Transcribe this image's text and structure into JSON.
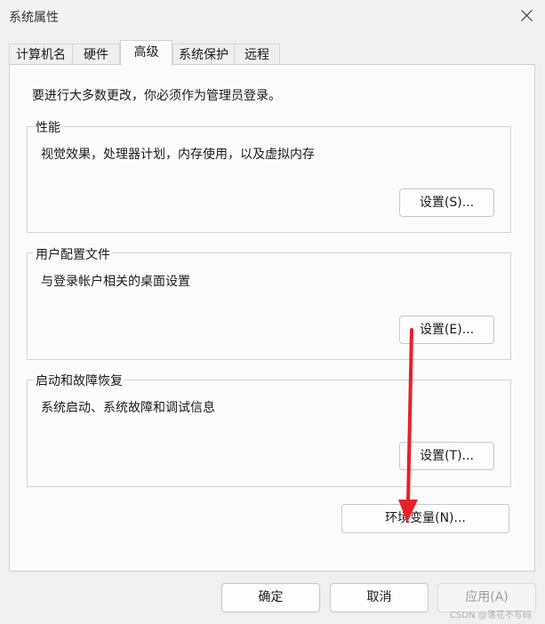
{
  "window": {
    "title": "系统属性"
  },
  "tabs": [
    {
      "label": "计算机名"
    },
    {
      "label": "硬件"
    },
    {
      "label": "高级"
    },
    {
      "label": "系统保护"
    },
    {
      "label": "远程"
    }
  ],
  "active_tab": "高级",
  "notice": "要进行大多数更改，你必须作为管理员登录。",
  "groups": {
    "performance": {
      "label": "性能",
      "description": "视觉效果，处理器计划，内存使用，以及虚拟内存",
      "button": "设置(S)..."
    },
    "user_profiles": {
      "label": "用户配置文件",
      "description": "与登录帐户相关的桌面设置",
      "button": "设置(E)..."
    },
    "startup_recovery": {
      "label": "启动和故障恢复",
      "description": "系统启动、系统故障和调试信息",
      "button": "设置(T)..."
    }
  },
  "env_button": "环境变量(N)...",
  "footer": {
    "ok": "确定",
    "cancel": "取消",
    "apply": "应用(A)"
  },
  "watermark": "CSDN @落花不写码",
  "annotation_color": "#e8202a"
}
